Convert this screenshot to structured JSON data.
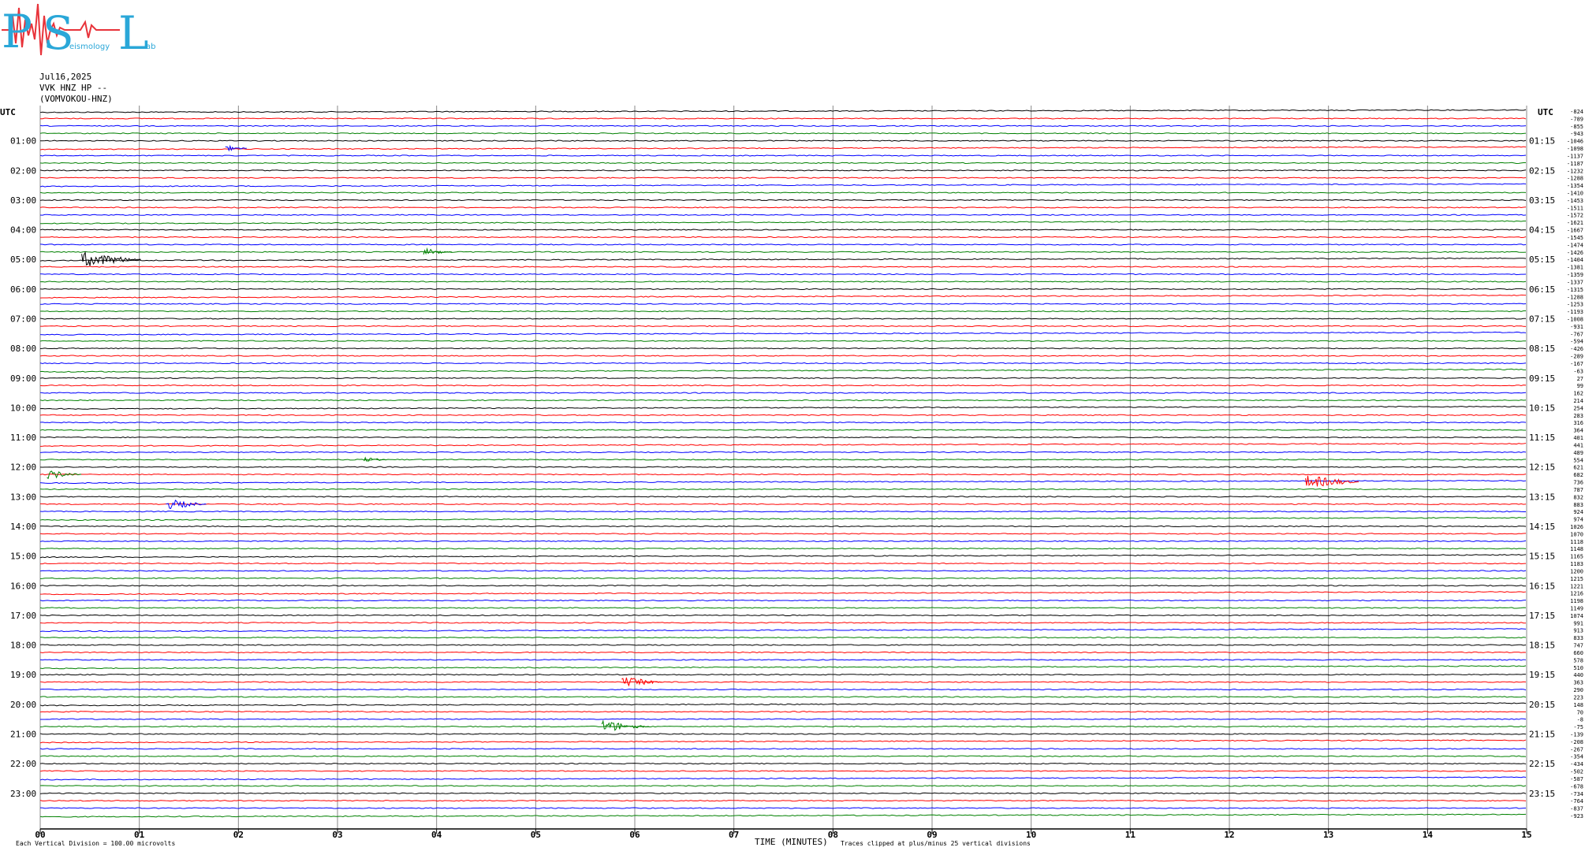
{
  "header": {
    "logo_letters": [
      "P",
      "S",
      "L"
    ],
    "logo_words": [
      "eismology",
      "ab"
    ],
    "date": "Jul16,2025",
    "channel": "VVK HNZ HP --",
    "station": "(VOMVOKOU-HNZ)"
  },
  "chart_data": {
    "type": "line",
    "title": "",
    "xlabel": "TIME (MINUTES)",
    "left_axis_label": "UTC",
    "right_axis_label": "UTC",
    "xlim": [
      0,
      15
    ],
    "x_ticks": [
      "00",
      "01",
      "02",
      "03",
      "04",
      "05",
      "06",
      "07",
      "08",
      "09",
      "10",
      "11",
      "12",
      "13",
      "14",
      "15"
    ],
    "left_hour_labels": [
      "01:00",
      "02:00",
      "03:00",
      "04:00",
      "05:00",
      "06:00",
      "07:00",
      "08:00",
      "09:00",
      "10:00",
      "11:00",
      "12:00",
      "13:00",
      "14:00",
      "15:00",
      "16:00",
      "17:00",
      "18:00",
      "19:00",
      "20:00",
      "21:00",
      "22:00",
      "23:00"
    ],
    "right_hour_labels": [
      "01:15",
      "02:15",
      "03:15",
      "04:15",
      "05:15",
      "06:15",
      "07:15",
      "08:15",
      "09:15",
      "10:15",
      "11:15",
      "12:15",
      "13:15",
      "14:15",
      "15:15",
      "16:15",
      "17:15",
      "18:15",
      "19:15",
      "20:15",
      "21:15",
      "22:15",
      "23:15"
    ],
    "trace_colors": [
      "#000000",
      "#ff0000",
      "#0000ff",
      "#008000"
    ],
    "trace_count": 96,
    "right_offsets": [
      "-824",
      "-789",
      "-855",
      "-943",
      "-1046",
      "-1098",
      "-1137",
      "-1187",
      "-1232",
      "-1288",
      "-1354",
      "-1410",
      "-1453",
      "-1511",
      "-1572",
      "-1621",
      "-1667",
      "-1545",
      "-1474",
      "-1426",
      "-1404",
      "-1381",
      "-1359",
      "-1337",
      "-1315",
      "-1288",
      "-1253",
      "-1193",
      "-1008",
      "-931",
      "-767",
      "-594",
      "-426",
      "-289",
      "-167",
      "-63",
      "27",
      "99",
      "162",
      "214",
      "254",
      "283",
      "316",
      "364",
      "401",
      "441",
      "489",
      "554",
      "621",
      "682",
      "736",
      "787",
      "832",
      "883",
      "924",
      "974",
      "1026",
      "1070",
      "1118",
      "1148",
      "1165",
      "1183",
      "1200",
      "1215",
      "1221",
      "1216",
      "1198",
      "1149",
      "1074",
      "991",
      "913",
      "833",
      "747",
      "660",
      "578",
      "510",
      "440",
      "363",
      "290",
      "223",
      "148",
      "70",
      "-8",
      "-75",
      "-139",
      "-208",
      "-267",
      "-354",
      "-434",
      "-502",
      "-587",
      "-678",
      "-734",
      "-764",
      "-837",
      "-923"
    ],
    "events": [
      {
        "trace": 5,
        "minute": 1.9,
        "color": "#0000ff",
        "amp": 3
      },
      {
        "trace": 19,
        "minute": 3.9,
        "color": "#008000",
        "amp": 4
      },
      {
        "trace": 20,
        "minute": 0.45,
        "color": "#000000",
        "amp": 9
      },
      {
        "trace": 47,
        "minute": 3.3,
        "color": "#008000",
        "amp": 3
      },
      {
        "trace": 49,
        "minute": 0.1,
        "color": "#008000",
        "amp": 5
      },
      {
        "trace": 50,
        "minute": 12.8,
        "color": "#ff0000",
        "amp": 8
      },
      {
        "trace": 53,
        "minute": 1.3,
        "color": "#0000ff",
        "amp": 6
      },
      {
        "trace": 77,
        "minute": 5.9,
        "color": "#ff0000",
        "amp": 6
      },
      {
        "trace": 83,
        "minute": 5.7,
        "color": "#008000",
        "amp": 7
      }
    ]
  },
  "footer": {
    "left_note": "Each Vertical Division =  100.00 microvolts",
    "right_note": "Traces clipped at plus/minus 25 vertical divisions"
  }
}
